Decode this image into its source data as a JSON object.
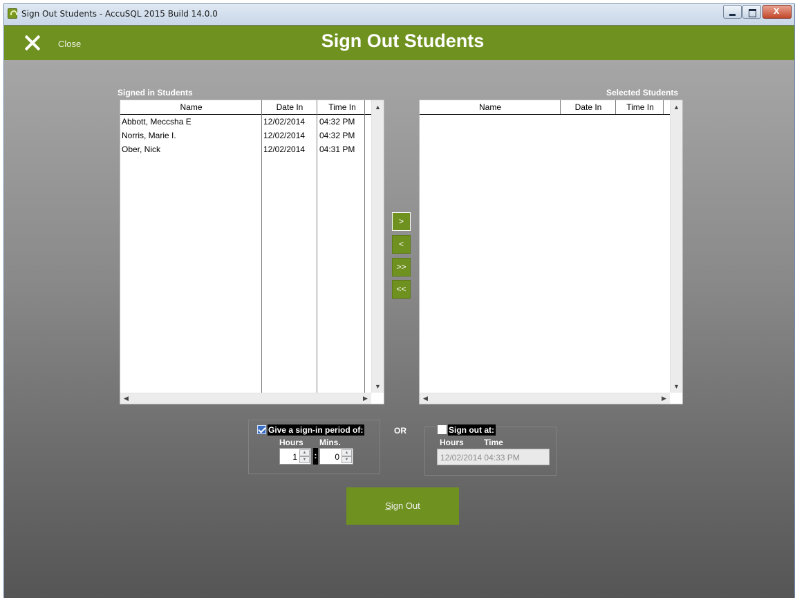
{
  "window": {
    "title": "Sign Out Students - AccuSQL 2015 Build 14.0.0"
  },
  "header": {
    "close_label": "Close",
    "title": "Sign Out Students"
  },
  "signed_in": {
    "label": "Signed in Students",
    "columns": [
      "Name",
      "Date In",
      "Time In"
    ],
    "rows": [
      {
        "name": "Abbott, Meccsha E",
        "date_in": "12/02/2014",
        "time_in": "04:32 PM"
      },
      {
        "name": "Norris, Marie I.",
        "date_in": "12/02/2014",
        "time_in": "04:32 PM"
      },
      {
        "name": "Ober, Nick",
        "date_in": "12/02/2014",
        "time_in": "04:31 PM"
      }
    ]
  },
  "selected": {
    "label": "Selected Students",
    "columns": [
      "Name",
      "Date In",
      "Time In"
    ],
    "rows": []
  },
  "move_buttons": {
    "add_one": ">",
    "remove_one": "<",
    "add_all": ">>",
    "remove_all": "<<"
  },
  "period_option": {
    "label": "Give a sign-in period of:",
    "checked": true,
    "hours_label": "Hours",
    "mins_label": "Mins.",
    "hours_value": "1",
    "mins_value": "0",
    "separator": ":"
  },
  "or_label": "OR",
  "signout_at_option": {
    "label": "Sign out at:",
    "checked": false,
    "hours_label": "Hours",
    "time_label": "Time",
    "value": "12/02/2014 04:33 PM"
  },
  "signout_button": {
    "label": "Sign Out",
    "accelerator": "S"
  },
  "colors": {
    "accent_green": "#6f9120",
    "header_green": "#6f9120"
  }
}
